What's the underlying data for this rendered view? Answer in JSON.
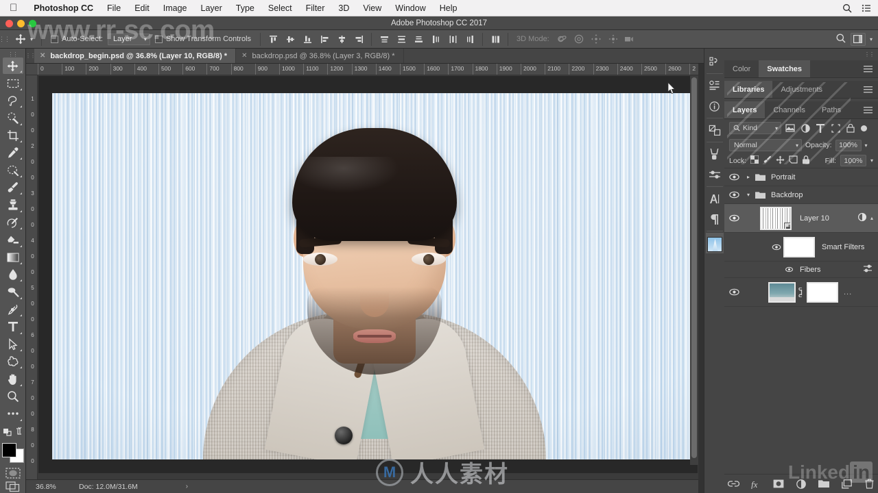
{
  "macmenu": {
    "apple": "",
    "items": [
      "Photoshop CC",
      "File",
      "Edit",
      "Image",
      "Layer",
      "Type",
      "Select",
      "Filter",
      "3D",
      "View",
      "Window",
      "Help"
    ],
    "right_icons": [
      "search-icon",
      "control-center-icon"
    ]
  },
  "titlebar": {
    "title": "Adobe Photoshop CC 2017"
  },
  "options": {
    "tool_icon": "move-tool-icon",
    "auto_select_label": "Auto-Select:",
    "auto_select_value": "Layer",
    "show_transform_label": "Show Transform Controls",
    "threeD_mode_label": "3D Mode:",
    "align_icons": [
      "align-left-edges-icon",
      "align-horizontal-centers-icon",
      "align-right-edges-icon",
      "align-top-edges-icon",
      "align-vertical-centers-icon",
      "align-bottom-edges-icon"
    ],
    "distribute_icons": [
      "distribute-top-icon",
      "distribute-vertical-center-icon",
      "distribute-bottom-icon",
      "distribute-left-icon",
      "distribute-horizontal-center-icon",
      "distribute-right-icon"
    ],
    "more_icon": "distribute-spacing-icon",
    "threeD_icons": [
      "orbit-3d-icon",
      "roll-3d-icon",
      "pan-3d-icon",
      "slide-3d-icon",
      "camera-3d-icon"
    ],
    "search_icon": "search-icon",
    "workspace_icon": "workspace-switcher-icon"
  },
  "tabs": [
    {
      "label": "backdrop_begin.psd @ 36.8% (Layer 10, RGB/8) *",
      "active": true
    },
    {
      "label": "backdrop.psd @ 36.8% (Layer 3, RGB/8) *",
      "active": false
    }
  ],
  "rulers": {
    "horizontal": [
      "0",
      "100",
      "200",
      "300",
      "400",
      "500",
      "600",
      "700",
      "800",
      "900",
      "1000",
      "1100",
      "1200",
      "1300",
      "1400",
      "1500",
      "1600",
      "1700",
      "1800",
      "1900",
      "2000",
      "2100",
      "2200",
      "2300",
      "2400",
      "2500",
      "2600",
      "2"
    ],
    "vertical": [
      "1",
      "0",
      "0",
      "2",
      "0",
      "0",
      "3",
      "0",
      "0",
      "4",
      "0",
      "0",
      "5",
      "0",
      "0",
      "6",
      "0",
      "0",
      "7",
      "0",
      "0",
      "8",
      "0",
      "0"
    ]
  },
  "statusbar": {
    "zoom": "36.8%",
    "doc": "Doc: 12.0M/31.6M",
    "arrow": "›"
  },
  "toolbar": {
    "tools": [
      {
        "name": "move-tool",
        "active": true
      },
      {
        "name": "rectangular-marquee-tool",
        "active": false
      },
      {
        "name": "lasso-tool",
        "active": false
      },
      {
        "name": "quick-selection-tool",
        "active": false
      },
      {
        "name": "crop-tool",
        "active": false
      },
      {
        "name": "eyedropper-tool",
        "active": false
      },
      {
        "name": "spot-healing-brush-tool",
        "active": false
      },
      {
        "name": "brush-tool",
        "active": false
      },
      {
        "name": "clone-stamp-tool",
        "active": false
      },
      {
        "name": "history-brush-tool",
        "active": false
      },
      {
        "name": "eraser-tool",
        "active": false
      },
      {
        "name": "gradient-tool",
        "active": false
      },
      {
        "name": "blur-tool",
        "active": false
      },
      {
        "name": "dodge-tool",
        "active": false
      },
      {
        "name": "pen-tool",
        "active": false
      },
      {
        "name": "horizontal-type-tool",
        "active": false
      },
      {
        "name": "path-selection-tool",
        "active": false
      },
      {
        "name": "custom-shape-tool",
        "active": false
      },
      {
        "name": "hand-tool",
        "active": false
      },
      {
        "name": "zoom-tool",
        "active": false
      },
      {
        "name": "edit-toolbar-tool",
        "active": false
      }
    ],
    "foreground_color": "#000000",
    "background_color": "#ffffff",
    "quick_mask_icon": "quick-mask-icon",
    "screen_mode_icon": "screen-mode-icon"
  },
  "rail": {
    "items": [
      "history-panel-icon",
      "properties-panel-icon",
      "info-panel-icon",
      "layer-comps-panel-icon",
      "brush-panel-icon",
      "brush-settings-panel-icon",
      "character-panel-icon",
      "paragraph-panel-icon",
      "timeline-thumbnail-icon"
    ]
  },
  "panels": {
    "group_color": {
      "tabs": [
        {
          "label": "Color",
          "active": false
        },
        {
          "label": "Swatches",
          "active": true
        }
      ]
    },
    "group_libraries": {
      "tabs": [
        {
          "label": "Libraries",
          "active": true
        },
        {
          "label": "Adjustments",
          "active": false
        }
      ]
    },
    "group_layers": {
      "tabs": [
        {
          "label": "Layers",
          "active": true
        },
        {
          "label": "Channels",
          "active": false
        },
        {
          "label": "Paths",
          "active": false
        }
      ]
    },
    "filter": {
      "kind_label": "Kind",
      "icons": [
        "filter-pixel-icon",
        "filter-adjustment-icon",
        "filter-type-icon",
        "filter-shape-icon",
        "filter-smartobject-icon"
      ],
      "toggle": "filter-toggle-icon"
    },
    "blend": {
      "mode": "Normal",
      "opacity_label": "Opacity:",
      "opacity_value": "100%"
    },
    "lock": {
      "label": "Lock:",
      "icons": [
        "lock-transparent-pixels-icon",
        "lock-image-pixels-icon",
        "lock-position-icon",
        "lock-artboard-icon",
        "lock-all-icon"
      ],
      "fill_label": "Fill:",
      "fill_value": "100%"
    },
    "layers": [
      {
        "name": "Portrait",
        "type": "group",
        "expanded": false,
        "visible": true,
        "selected": false
      },
      {
        "name": "Backdrop",
        "type": "group",
        "expanded": true,
        "visible": true,
        "selected": false
      },
      {
        "name": "Layer 10",
        "type": "smart-object",
        "visible": true,
        "selected": true
      },
      {
        "name": "Smart Filters",
        "type": "smart-filters",
        "visible": true,
        "selected": false
      },
      {
        "name": "Fibers",
        "type": "filter",
        "visible": true,
        "selected": false
      },
      {
        "name": "",
        "type": "image-with-mask",
        "visible": true,
        "selected": false,
        "trailing": "..."
      }
    ],
    "bottom_icons": [
      "link-layers-icon",
      "add-layer-style-icon",
      "add-layer-mask-icon",
      "new-adjustment-layer-icon",
      "new-group-icon",
      "new-layer-icon",
      "delete-layer-icon"
    ]
  },
  "watermarks": {
    "url": "www.rr-sc.com",
    "linkedin_text": "Linked",
    "linkedin_badge": "in",
    "chinese": "人人素材",
    "chinese_logo": "M"
  }
}
